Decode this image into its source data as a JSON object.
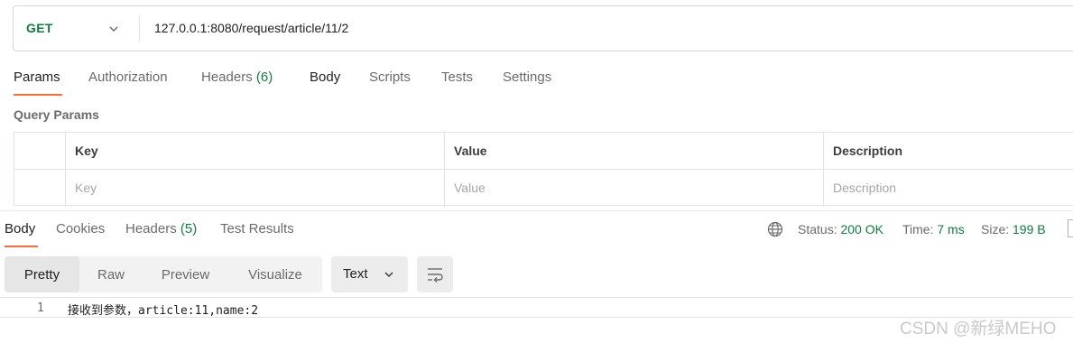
{
  "request": {
    "method": "GET",
    "url": "127.0.0.1:8080/request/article/11/2"
  },
  "request_tabs": [
    {
      "label": "Params",
      "count": "",
      "active": true
    },
    {
      "label": "Authorization",
      "count": ""
    },
    {
      "label": "Headers",
      "count": "(6)"
    },
    {
      "label": "Body",
      "count": ""
    },
    {
      "label": "Scripts",
      "count": ""
    },
    {
      "label": "Tests",
      "count": ""
    },
    {
      "label": "Settings",
      "count": ""
    }
  ],
  "query_params": {
    "title": "Query Params",
    "columns": [
      "Key",
      "Value",
      "Description"
    ],
    "placeholders": [
      "Key",
      "Value",
      "Description"
    ]
  },
  "response_tabs": [
    {
      "label": "Body",
      "count": "",
      "active": true
    },
    {
      "label": "Cookies",
      "count": ""
    },
    {
      "label": "Headers",
      "count": "(5)"
    },
    {
      "label": "Test Results",
      "count": ""
    }
  ],
  "response_status": {
    "status_label": "Status:",
    "status_value": "200 OK",
    "time_label": "Time:",
    "time_value": "7 ms",
    "size_label": "Size:",
    "size_value": "199 B"
  },
  "view_modes": [
    "Pretty",
    "Raw",
    "Preview",
    "Visualize"
  ],
  "active_view_mode": "Pretty",
  "format": "Text",
  "response_body": {
    "line_number": "1",
    "content": "接收到参数，article:11,name:2"
  },
  "watermark": "CSDN @新绿MEHO",
  "colors": {
    "accent": "#ff6c37",
    "success": "#0f7d3b"
  },
  "icons": [
    "chevron-down-icon",
    "globe-icon",
    "wrap-lines-icon"
  ]
}
